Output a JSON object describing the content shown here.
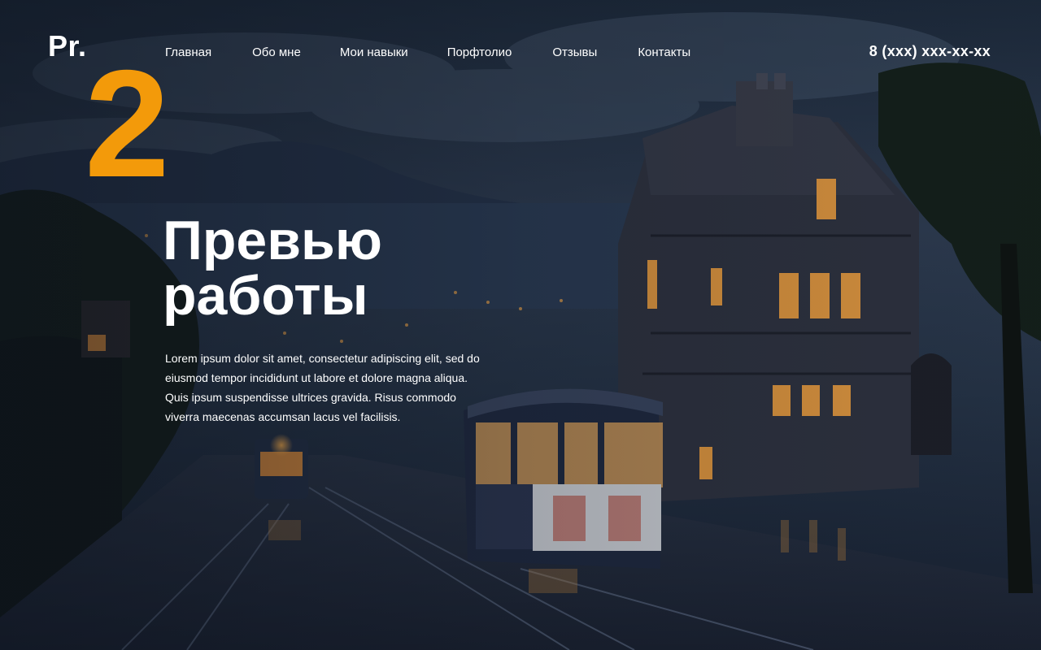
{
  "logo": {
    "text": "Pr."
  },
  "nav": {
    "items": [
      {
        "label": "Главная"
      },
      {
        "label": "Обо мне"
      },
      {
        "label": "Мои навыки"
      },
      {
        "label": "Порфтолио"
      },
      {
        "label": "Отзывы"
      },
      {
        "label": "Контакты"
      }
    ]
  },
  "phone": {
    "text": "8 (xxx) xxx-xx-xx"
  },
  "hero": {
    "number": "2",
    "title_line1": "Превью",
    "title_line2": "работы",
    "description": "Lorem ipsum dolor sit amet, consectetur adipiscing elit, sed do eiusmod tempor incididunt ut labore et dolore magna aliqua. Quis ipsum suspendisse ultrices gravida. Risus commodo viverra maecenas accumsan lacus vel facilisis."
  },
  "colors": {
    "accent": "#f39a0a",
    "text": "#ffffff",
    "background": "#1b2536"
  },
  "background_image": {
    "subject": "night city street with tram and house"
  }
}
